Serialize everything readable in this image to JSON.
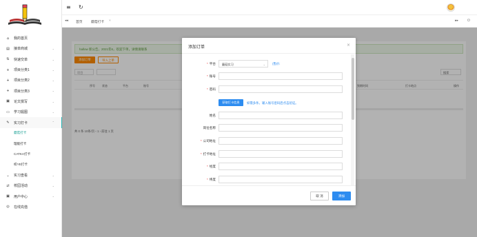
{
  "sidebar": {
    "items": [
      {
        "icon": "⌂",
        "label": "我的首页",
        "arrow": ""
      },
      {
        "icon": "▤",
        "label": "接单商城",
        "arrow": "⌄"
      },
      {
        "icon": "⇅",
        "label": "快速交单",
        "arrow": "⌄"
      },
      {
        "icon": "+",
        "label": "项目分类1",
        "arrow": "⌄"
      },
      {
        "icon": "+",
        "label": "项目分类2",
        "arrow": "⌄"
      },
      {
        "icon": "+",
        "label": "项目分类3",
        "arrow": "⌄"
      },
      {
        "icon": "▣",
        "label": "论文撰写",
        "arrow": "⌄"
      },
      {
        "icon": "▭",
        "label": "学习掘图",
        "arrow": "⌄"
      },
      {
        "icon": "✎",
        "label": "实习打卡",
        "arrow": "⌃"
      }
    ],
    "sub_items": [
      {
        "label": "蘑菇打卡",
        "active": true
      },
      {
        "label": "理能打卡",
        "active": false
      },
      {
        "label": "CATKA打卡",
        "active": false
      },
      {
        "label": "校YE打卡",
        "active": false
      }
    ],
    "items_after": [
      {
        "icon": "⌄",
        "label": "实习查看",
        "arrow": "⌄"
      },
      {
        "icon": "⇄",
        "label": "校园活动",
        "arrow": "⌄"
      },
      {
        "icon": "▣",
        "label": "用户中心",
        "arrow": "⌄"
      },
      {
        "icon": "◎",
        "label": "在线充值",
        "arrow": ""
      }
    ]
  },
  "topbar": {
    "menu_icon": "≡",
    "refresh_icon": "↻",
    "user_name": ""
  },
  "tabs": {
    "prev_icon": "◂◂",
    "home": "首页",
    "current": "蘑菇打卡",
    "current_close": "×",
    "next_icon": "▸▸",
    "power_icon": "⏻"
  },
  "background": {
    "notice": "hallow 新公告，2021年6，欢迎下单，详情请联系",
    "add_button": "添加订单",
    "batch_button": "导入上单",
    "filter_placeholder": "项目",
    "search_label": "搜索",
    "columns": [
      "序号",
      "状态",
      "平台",
      "账号",
      "到期时间",
      "打卡地点",
      "操作"
    ],
    "pager": "共 0 条    10条/页    ‹   1   ›    前往   1   页"
  },
  "modal": {
    "title": "添加订单",
    "close_icon": "×",
    "platform_label": "平台",
    "platform_value": "蘑菇实习",
    "price_label": "(售价:",
    "price_value": "",
    "account_label": "账号",
    "password_label": "密码",
    "fetch_button": "获取打卡信息",
    "fetch_hint": "如需多条，输入账号密码后点击验证。",
    "name_label": "姓名",
    "position_label": "岗位名称",
    "company_label": "公司地址",
    "checkin_label": "打卡地址",
    "longitude_label": "经度",
    "latitude_label": "纬度",
    "cancel_button": "取 消",
    "confirm_button": "添加"
  }
}
